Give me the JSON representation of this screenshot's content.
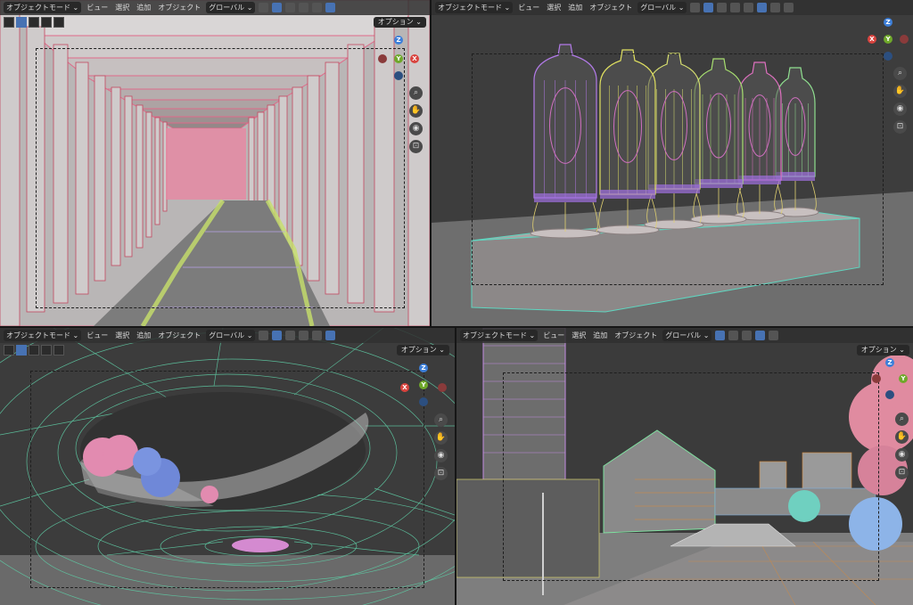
{
  "header": {
    "mode_label": "オブジェクトモード",
    "menu_view": "ビュー",
    "menu_select": "選択",
    "menu_add": "追加",
    "menu_object": "オブジェクト",
    "transform_label": "グローバル",
    "options_label": "オプション"
  },
  "gizmo": {
    "z": "Z",
    "y": "Y",
    "x": "X"
  },
  "colors": {
    "viewport_bg": "#3d3d3d",
    "header_bg": "#303030",
    "accent": "#4772b3",
    "axis_x": "#d9443f",
    "axis_y": "#6fa82a",
    "axis_z": "#3d7fd9"
  },
  "icons": [
    "zoom-icon",
    "hand-icon",
    "camera-icon",
    "lock-icon"
  ]
}
